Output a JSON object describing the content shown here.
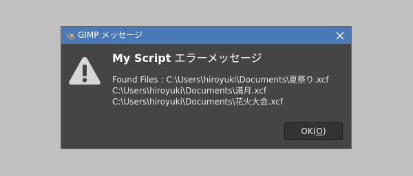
{
  "window": {
    "title": "GIMP メッセージ",
    "icon": "gimp-wilber-icon",
    "close_icon": "close-icon"
  },
  "dialog": {
    "heading_bold": "My Script",
    "heading_rest": " エラーメッセージ",
    "icon": "warning-icon",
    "message_lines": [
      "Found Files : C:\\Users\\hiroyuki\\Documents\\夏祭り.xcf",
      "C:\\Users\\hiroyuki\\Documents\\満月.xcf",
      "C:\\Users\\hiroyuki\\Documents\\花火大会.xcf"
    ]
  },
  "buttons": {
    "ok_prefix": "OK(",
    "ok_mnemonic": "O",
    "ok_suffix": ")"
  },
  "colors": {
    "titlebar": "#4a79b8",
    "dialog_bg": "#454545",
    "desktop_bg": "#c0c0c0",
    "icon_gray": "#d6d6d6"
  }
}
